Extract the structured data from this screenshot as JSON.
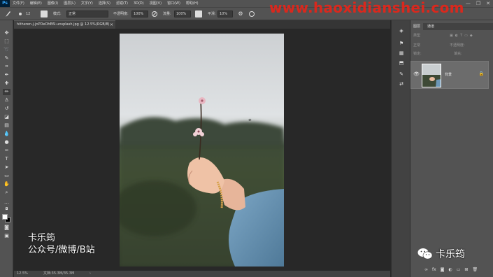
{
  "menubar": {
    "logo": "Ps",
    "items": [
      "文件(F)",
      "编辑(E)",
      "图像(I)",
      "图层(L)",
      "文字(Y)",
      "选择(S)",
      "滤镜(T)",
      "3D(D)",
      "视图(V)",
      "窗口(W)",
      "帮助(H)"
    ],
    "window_controls": [
      "—",
      "❐",
      "✕"
    ]
  },
  "options": {
    "brush_size": "12",
    "mode_label": "模式:",
    "mode_value": "正常",
    "opacity_label": "不透明度:",
    "opacity_value": "100%",
    "flow_label": "流量:",
    "flow_value": "100%",
    "smooth_label": "平滑:",
    "smooth_value": "10%"
  },
  "document": {
    "tab_title": "hitheren-j-jnPDeOhE6I-unsplash.jpg @ 12.5%(RGB/8)",
    "zoom": "12.5%",
    "doc_info": "文档:35.3M/35.3M"
  },
  "layers_panel": {
    "tabs": [
      "图层",
      "通道"
    ],
    "kind_label": "类型",
    "blend_mode": "正常",
    "opacity_label": "不透明度:",
    "lock_label": "锁定:",
    "fill_label": "填充:",
    "layer_name": "背景"
  },
  "watermark": {
    "url": "www.haoxidianshei.com"
  },
  "overlay": {
    "author": "卡乐筠",
    "channels": "公众号/微博/B站",
    "wechat_name": "卡乐筠"
  }
}
